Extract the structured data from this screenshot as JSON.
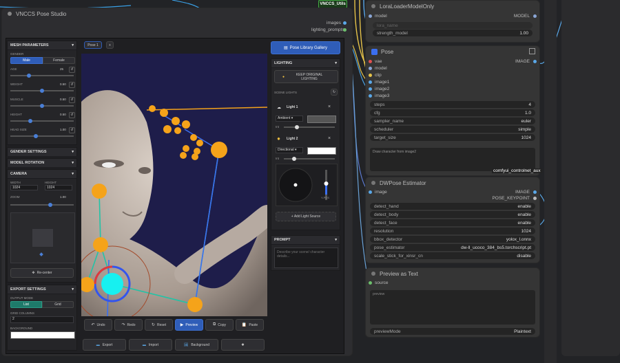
{
  "top_nodes": {
    "vnccs_utils": "VNCCS_Utils",
    "lora_loader": {
      "title": "LoraLoaderModelOnly",
      "input_model": "model",
      "output_model": "MODEL",
      "lora_name": "lora_name",
      "strength_label": "strength_model",
      "strength_value": "1.00"
    }
  },
  "studio": {
    "title": "VNCCS Pose Studio",
    "outputs": [
      "images",
      "lighting_prompts"
    ],
    "tab": "Pose 1",
    "add_tab": "+",
    "mesh": {
      "title": "MESH PARAMETERS",
      "gender_label": "GENDER",
      "male": "Male",
      "female": "Female",
      "sliders": [
        {
          "label": "AGE",
          "value": "25",
          "pos": 0.28
        },
        {
          "label": "WEIGHT",
          "value": "0.50",
          "pos": 0.5
        },
        {
          "label": "MUSCLE",
          "value": "0.50",
          "pos": 0.5
        },
        {
          "label": "HEIGHT",
          "value": "0.50",
          "pos": 0.3
        },
        {
          "label": "HEAD SIZE",
          "value": "1.00",
          "pos": 0.4
        }
      ]
    },
    "gender_settings": "GENDER SETTINGS",
    "model_rotation": "MODEL ROTATION",
    "camera": {
      "title": "CAMERA",
      "width_label": "WIDTH",
      "width": "1024",
      "height_label": "HEIGHT",
      "height": "1024",
      "zoom_label": "ZOOM",
      "zoom": "1.00",
      "zoom_pos": 0.6,
      "recenter": "Re-center"
    },
    "export": {
      "title": "EXPORT SETTINGS",
      "output_mode": "OUTPUT MODE",
      "list": "List",
      "grid": "Grid",
      "grid_columns": "GRID COLUMNS",
      "columns": "2",
      "background": "BACKGROUND"
    },
    "toolbar": [
      "Undo",
      "Redo",
      "Reset",
      "Preview",
      "Copy",
      "Paste"
    ],
    "bottom": [
      "Export",
      "Import",
      "Background",
      "✱"
    ],
    "gallery_button": "Pose Library Gallery",
    "lighting": {
      "title": "LIGHTING",
      "keep_original": "KEEP ORIGINAL LIGHTING",
      "scene_lights": "SCENE LIGHTS",
      "light1": {
        "name": "Light 1",
        "type": "Ambient",
        "int": "Int"
      },
      "light2": {
        "name": "Light 2",
        "type": "Directional",
        "int": "Int",
        "y_label": "Y-POS"
      },
      "add_light": "+ Add Light Source"
    },
    "prompt": {
      "title": "PROMPT",
      "placeholder": "Describe your scene/ character details..."
    }
  },
  "pose_node": {
    "title": "Pose",
    "inputs": [
      "vae",
      "model",
      "clip",
      "image1",
      "image2",
      "image3"
    ],
    "output": "IMAGE",
    "widgets": [
      {
        "label": "steps",
        "value": "4"
      },
      {
        "label": "cfg",
        "value": "1.0"
      },
      {
        "label": "sampler_name",
        "value": "euler"
      },
      {
        "label": "scheduler",
        "value": "simple"
      },
      {
        "label": "target_size",
        "value": "1024"
      }
    ],
    "prompt_text": "Draw character from image2",
    "badge": "comfyui_controlnet_aux"
  },
  "dwpose": {
    "title": "DWPose Estimator",
    "input": "image",
    "outputs": [
      "IMAGE",
      "POSE_KEYPOINT"
    ],
    "widgets": [
      {
        "label": "detect_hand",
        "value": "enable"
      },
      {
        "label": "detect_body",
        "value": "enable"
      },
      {
        "label": "detect_face",
        "value": "enable"
      },
      {
        "label": "resolution",
        "value": "1024"
      },
      {
        "label": "bbox_detector",
        "value": "yolox_l.onnx"
      },
      {
        "label": "pose_estimator",
        "value": "dw-ll_ucoco_384_bs5.torchscript.pt"
      },
      {
        "label": "scale_stick_for_xinsr_cn",
        "value": "disable"
      }
    ]
  },
  "preview_text": {
    "title": "Preview as Text",
    "input": "source",
    "box_label": "preview",
    "mode_label": "previewMode",
    "mode_value": "Plaintext"
  },
  "colors": {
    "accent": "#2f5db8",
    "canvas_bg": "#222326",
    "node_bg": "#353535",
    "viewport_bg": "#1e1d4a",
    "joint": "#f5a31a",
    "cyan": "#17f0f0"
  }
}
